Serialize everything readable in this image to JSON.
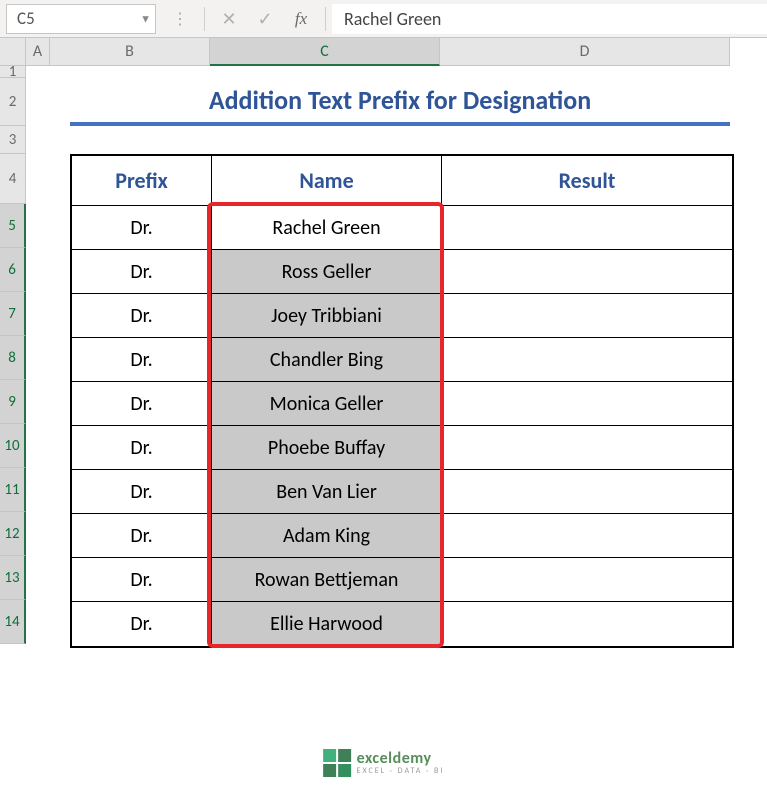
{
  "formula_bar": {
    "cell_ref": "C5",
    "cancel": "✕",
    "confirm": "✓",
    "fx": "fx",
    "value": "Rachel Green"
  },
  "columns": {
    "A": "A",
    "B": "B",
    "C": "C",
    "D": "D"
  },
  "rows": [
    "1",
    "2",
    "3",
    "4",
    "5",
    "6",
    "7",
    "8",
    "9",
    "10",
    "11",
    "12",
    "13",
    "14"
  ],
  "title": "Addition Text Prefix for Designation",
  "headers": {
    "prefix": "Prefix",
    "name": "Name",
    "result": "Result"
  },
  "data": [
    {
      "prefix": "Dr.",
      "name": "Rachel Green",
      "result": ""
    },
    {
      "prefix": "Dr.",
      "name": "Ross Geller",
      "result": ""
    },
    {
      "prefix": "Dr.",
      "name": "Joey Tribbiani",
      "result": ""
    },
    {
      "prefix": "Dr.",
      "name": "Chandler Bing",
      "result": ""
    },
    {
      "prefix": "Dr.",
      "name": "Monica Geller",
      "result": ""
    },
    {
      "prefix": "Dr.",
      "name": "Phoebe Buffay",
      "result": ""
    },
    {
      "prefix": "Dr.",
      "name": "Ben Van Lier",
      "result": ""
    },
    {
      "prefix": "Dr.",
      "name": "Adam King",
      "result": ""
    },
    {
      "prefix": "Dr.",
      "name": "Rowan Bettjeman",
      "result": ""
    },
    {
      "prefix": "Dr.",
      "name": "Ellie Harwood",
      "result": ""
    }
  ],
  "watermark": {
    "name": "exceldemy",
    "tagline": "EXCEL · DATA · BI"
  }
}
